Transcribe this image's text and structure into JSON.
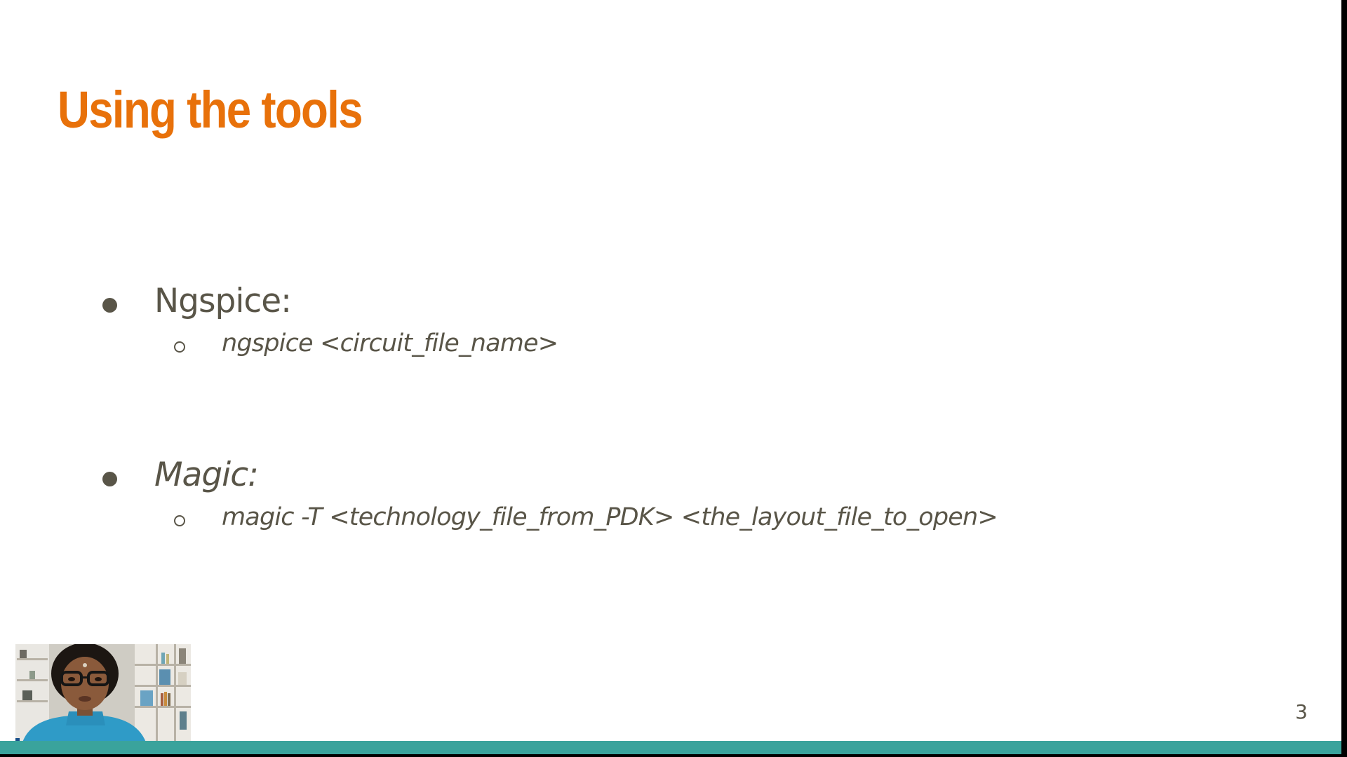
{
  "slide": {
    "title": "Using the tools",
    "sections": [
      {
        "label": "Ngspice:",
        "command": "ngspice <circuit_file_name>"
      },
      {
        "label": "Magic:",
        "command": "magic -T <technology_file_from_PDK> <the_layout_file_to_open>"
      }
    ],
    "page_number": "3"
  },
  "colors": {
    "title": "#e8710a",
    "body_text": "#595548",
    "bullet": "#595548",
    "accent_bar": "#3aa39c",
    "slide_background": "#ffffff"
  },
  "icons": {
    "level1_bullet": "filled-circle",
    "level2_bullet": "hollow-circle"
  }
}
